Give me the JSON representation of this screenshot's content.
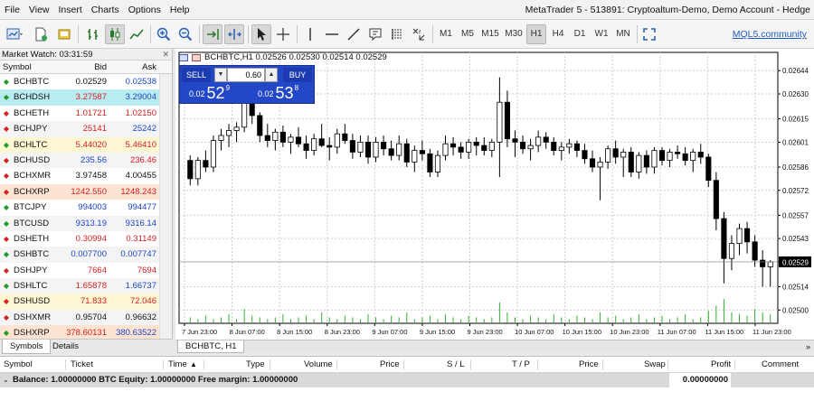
{
  "menu": {
    "items": [
      "File",
      "View",
      "Insert",
      "Charts",
      "Options",
      "Help"
    ],
    "app_title": "MetaTrader 5 - 513891: Cryptoaltum-Demo, Demo Account - Hedge"
  },
  "toolbar": {
    "timeframes": [
      "M1",
      "M5",
      "M15",
      "M30",
      "H1",
      "H4",
      "D1",
      "W1",
      "MN"
    ],
    "selected_timeframe": "H1",
    "community_link": "MQL5.community"
  },
  "market_watch": {
    "title": "Market Watch: 03:31:59",
    "columns": {
      "symbol": "Symbol",
      "bid": "Bid",
      "ask": "Ask"
    },
    "rows": [
      {
        "symbol": "BCHBTC",
        "bid": "0.02529",
        "ask": "0.02538",
        "dir": "up",
        "bid_color": "black",
        "ask_color": "blue"
      },
      {
        "symbol": "BCHDSH",
        "bid": "3.27587",
        "ask": "3.29004",
        "dir": "up",
        "bid_color": "red",
        "ask_color": "blue",
        "highlight": "#b8ecf0"
      },
      {
        "symbol": "BCHETH",
        "bid": "1.01721",
        "ask": "1.02150",
        "dir": "down",
        "bid_color": "red",
        "ask_color": "red"
      },
      {
        "symbol": "BCHJPY",
        "bid": "25141",
        "ask": "25242",
        "dir": "down",
        "bid_color": "red",
        "ask_color": "blue"
      },
      {
        "symbol": "BCHLTC",
        "bid": "5.44020",
        "ask": "5.46410",
        "dir": "up",
        "bid_color": "red",
        "ask_color": "red",
        "highlight": "#fdf6d3"
      },
      {
        "symbol": "BCHUSD",
        "bid": "235.56",
        "ask": "236.46",
        "dir": "down",
        "bid_color": "blue",
        "ask_color": "red"
      },
      {
        "symbol": "BCHXMR",
        "bid": "3.97458",
        "ask": "4.00455",
        "dir": "down",
        "bid_color": "black",
        "ask_color": "black"
      },
      {
        "symbol": "BCHXRP",
        "bid": "1242.550",
        "ask": "1248.243",
        "dir": "down",
        "bid_color": "red",
        "ask_color": "red",
        "highlight": "#fde3d2"
      },
      {
        "symbol": "BTCJPY",
        "bid": "994003",
        "ask": "994477",
        "dir": "up",
        "bid_color": "blue",
        "ask_color": "blue"
      },
      {
        "symbol": "BTCUSD",
        "bid": "9313.19",
        "ask": "9316.14",
        "dir": "up",
        "bid_color": "blue",
        "ask_color": "blue"
      },
      {
        "symbol": "DSHETH",
        "bid": "0.30994",
        "ask": "0.31149",
        "dir": "down",
        "bid_color": "red",
        "ask_color": "red"
      },
      {
        "symbol": "DSHBTC",
        "bid": "0.007700",
        "ask": "0.007747",
        "dir": "up",
        "bid_color": "blue",
        "ask_color": "blue"
      },
      {
        "symbol": "DSHJPY",
        "bid": "7664",
        "ask": "7694",
        "dir": "down",
        "bid_color": "red",
        "ask_color": "red"
      },
      {
        "symbol": "DSHLTC",
        "bid": "1.65878",
        "ask": "1.66737",
        "dir": "up",
        "bid_color": "red",
        "ask_color": "blue"
      },
      {
        "symbol": "DSHUSD",
        "bid": "71.833",
        "ask": "72.046",
        "dir": "down",
        "bid_color": "red",
        "ask_color": "red",
        "highlight": "#fdf6d3"
      },
      {
        "symbol": "DSHXMR",
        "bid": "0.95704",
        "ask": "0.96632",
        "dir": "down",
        "bid_color": "black",
        "ask_color": "black"
      },
      {
        "symbol": "DSHXRP",
        "bid": "378.60131",
        "ask": "380.63522",
        "dir": "up",
        "bid_color": "red",
        "ask_color": "blue",
        "highlight": "#fde3d2"
      }
    ],
    "tabs": [
      "Symbols",
      "Details"
    ]
  },
  "chart": {
    "header": "BCHBTC,H1  0.02526 0.02530 0.02514 0.02529",
    "tab_label": "BCHBTC, H1",
    "trade": {
      "sell_label": "SELL",
      "buy_label": "BUY",
      "lot": "0.60",
      "sell_prefix": "0.02",
      "sell_big": "52",
      "sell_sup": "9",
      "buy_prefix": "0.02",
      "buy_big": "53",
      "buy_sup": "8"
    }
  },
  "chart_data": {
    "type": "candlestick",
    "symbol": "BCHBTC",
    "timeframe": "H1",
    "price_ticks": [
      "0.02644",
      "0.02630",
      "0.02615",
      "0.02601",
      "0.02586",
      "0.02572",
      "0.02557",
      "0.02543",
      "0.02529",
      "0.02514",
      "0.02500"
    ],
    "current_price": "0.02529",
    "ylim": [
      0.02492,
      0.02655
    ],
    "time_ticks": [
      "7 Jun 23:00",
      "8 Jun 07:00",
      "8 Jun 15:00",
      "8 Jun 23:00",
      "9 Jun 07:00",
      "9 Jun 15:00",
      "9 Jun 23:00",
      "10 Jun 07:00",
      "10 Jun 15:00",
      "10 Jun 23:00",
      "11 Jun 07:00",
      "11 Jun 15:00",
      "11 Jun 23:00"
    ],
    "colors": {
      "grid": "#cfcfcf",
      "candle": "#000000",
      "volume": "#2fb32f",
      "price_label_bg": "#000000"
    },
    "ohlc": [
      [
        0.0259,
        0.02593,
        0.02575,
        0.02579
      ],
      [
        0.02579,
        0.02592,
        0.02575,
        0.0259
      ],
      [
        0.0259,
        0.02596,
        0.02583,
        0.02586
      ],
      [
        0.02586,
        0.02605,
        0.02583,
        0.02602
      ],
      [
        0.02602,
        0.02609,
        0.02596,
        0.02605
      ],
      [
        0.02605,
        0.02612,
        0.02598,
        0.02608
      ],
      [
        0.02608,
        0.02613,
        0.02601,
        0.0261
      ],
      [
        0.0261,
        0.02628,
        0.02607,
        0.02625
      ],
      [
        0.02625,
        0.02632,
        0.02612,
        0.02617
      ],
      [
        0.02617,
        0.02619,
        0.02601,
        0.02605
      ],
      [
        0.02605,
        0.02612,
        0.02598,
        0.02602
      ],
      [
        0.02602,
        0.02609,
        0.02596,
        0.02607
      ],
      [
        0.02607,
        0.02611,
        0.02598,
        0.02601
      ],
      [
        0.02601,
        0.02606,
        0.02594,
        0.02604
      ],
      [
        0.02604,
        0.0261,
        0.02598,
        0.026
      ],
      [
        0.026,
        0.02605,
        0.02591,
        0.02596
      ],
      [
        0.02596,
        0.02606,
        0.02593,
        0.02603
      ],
      [
        0.02603,
        0.02612,
        0.02598,
        0.02599
      ],
      [
        0.02599,
        0.02604,
        0.0259,
        0.02598
      ],
      [
        0.02598,
        0.02609,
        0.02594,
        0.02606
      ],
      [
        0.02606,
        0.02612,
        0.026,
        0.02602
      ],
      [
        0.02602,
        0.02606,
        0.02591,
        0.02595
      ],
      [
        0.02595,
        0.02605,
        0.02592,
        0.02601
      ],
      [
        0.02601,
        0.02605,
        0.02588,
        0.02592
      ],
      [
        0.02592,
        0.02604,
        0.02589,
        0.02601
      ],
      [
        0.02601,
        0.02605,
        0.02593,
        0.02597
      ],
      [
        0.02597,
        0.02602,
        0.0259,
        0.02593
      ],
      [
        0.02593,
        0.02605,
        0.0259,
        0.026
      ],
      [
        0.026,
        0.02603,
        0.02586,
        0.02589
      ],
      [
        0.02589,
        0.02599,
        0.02583,
        0.02596
      ],
      [
        0.02596,
        0.02602,
        0.0259,
        0.02594
      ],
      [
        0.02594,
        0.02597,
        0.0258,
        0.02583
      ],
      [
        0.02583,
        0.02596,
        0.0258,
        0.02593
      ],
      [
        0.02593,
        0.02605,
        0.0259,
        0.026
      ],
      [
        0.026,
        0.02604,
        0.02593,
        0.02598
      ],
      [
        0.02598,
        0.02601,
        0.02591,
        0.02595
      ],
      [
        0.02595,
        0.02603,
        0.02591,
        0.02601
      ],
      [
        0.02601,
        0.02604,
        0.02593,
        0.02599
      ],
      [
        0.02599,
        0.02604,
        0.02593,
        0.02596
      ],
      [
        0.02596,
        0.02603,
        0.02592,
        0.02601
      ],
      [
        0.02601,
        0.0264,
        0.0258,
        0.02625
      ],
      [
        0.02625,
        0.02632,
        0.02598,
        0.02603
      ],
      [
        0.02603,
        0.02608,
        0.02592,
        0.02601
      ],
      [
        0.02601,
        0.02605,
        0.02594,
        0.02597
      ],
      [
        0.02597,
        0.02603,
        0.0259,
        0.02599
      ],
      [
        0.02599,
        0.02608,
        0.02595,
        0.02604
      ],
      [
        0.02604,
        0.02607,
        0.02597,
        0.02601
      ],
      [
        0.02601,
        0.02604,
        0.02593,
        0.02596
      ],
      [
        0.02596,
        0.02601,
        0.0259,
        0.02598
      ],
      [
        0.02598,
        0.02603,
        0.02594,
        0.026
      ],
      [
        0.026,
        0.02602,
        0.02592,
        0.02596
      ],
      [
        0.02596,
        0.026,
        0.02588,
        0.02591
      ],
      [
        0.02591,
        0.02596,
        0.02583,
        0.02586
      ],
      [
        0.02586,
        0.02592,
        0.02566,
        0.02589
      ],
      [
        0.02589,
        0.02599,
        0.02585,
        0.02597
      ],
      [
        0.02597,
        0.02602,
        0.02588,
        0.02592
      ],
      [
        0.02592,
        0.02597,
        0.0258,
        0.02595
      ],
      [
        0.02595,
        0.02598,
        0.0258,
        0.02583
      ],
      [
        0.02583,
        0.02595,
        0.02579,
        0.02593
      ],
      [
        0.02593,
        0.02596,
        0.02582,
        0.02586
      ],
      [
        0.02586,
        0.02598,
        0.02582,
        0.02596
      ],
      [
        0.02596,
        0.02598,
        0.02587,
        0.0259
      ],
      [
        0.0259,
        0.02597,
        0.02586,
        0.02595
      ],
      [
        0.02595,
        0.02599,
        0.02591,
        0.02594
      ],
      [
        0.02594,
        0.02598,
        0.02587,
        0.0259
      ],
      [
        0.0259,
        0.02597,
        0.02583,
        0.02595
      ],
      [
        0.02595,
        0.026,
        0.02588,
        0.02592
      ],
      [
        0.02592,
        0.02594,
        0.02574,
        0.02578
      ],
      [
        0.02578,
        0.02583,
        0.02548,
        0.02555
      ],
      [
        0.02555,
        0.02559,
        0.02516,
        0.02531
      ],
      [
        0.02531,
        0.02545,
        0.02524,
        0.0254
      ],
      [
        0.0254,
        0.02552,
        0.02533,
        0.02549
      ],
      [
        0.02549,
        0.02553,
        0.02534,
        0.02541
      ],
      [
        0.02541,
        0.02545,
        0.02526,
        0.0253
      ],
      [
        0.0253,
        0.02536,
        0.02514,
        0.02526
      ],
      [
        0.02526,
        0.0253,
        0.02514,
        0.02529
      ]
    ],
    "volumes": [
      3,
      2,
      4,
      2,
      3,
      5,
      2,
      8,
      4,
      3,
      2,
      3,
      5,
      2,
      3,
      4,
      2,
      6,
      3,
      2,
      4,
      3,
      2,
      5,
      3,
      2,
      4,
      3,
      6,
      2,
      3,
      4,
      2,
      5,
      3,
      2,
      4,
      3,
      2,
      3,
      12,
      6,
      3,
      2,
      4,
      3,
      2,
      5,
      3,
      2,
      4,
      3,
      2,
      6,
      3,
      4,
      2,
      3,
      5,
      2,
      3,
      4,
      2,
      3,
      5,
      2,
      3,
      7,
      10,
      14,
      6,
      5,
      4,
      8,
      6,
      5
    ]
  },
  "toolbox": {
    "columns": [
      "Symbol",
      "Ticket",
      "Time",
      "Type",
      "Volume",
      "Price",
      "S / L",
      "T / P",
      "Price",
      "Swap",
      "Profit",
      "Comment"
    ],
    "balance_text": "Balance: 1.00000000 BTC  Equity: 1.00000000  Free margin: 1.00000000",
    "profit": "0.00000000"
  }
}
